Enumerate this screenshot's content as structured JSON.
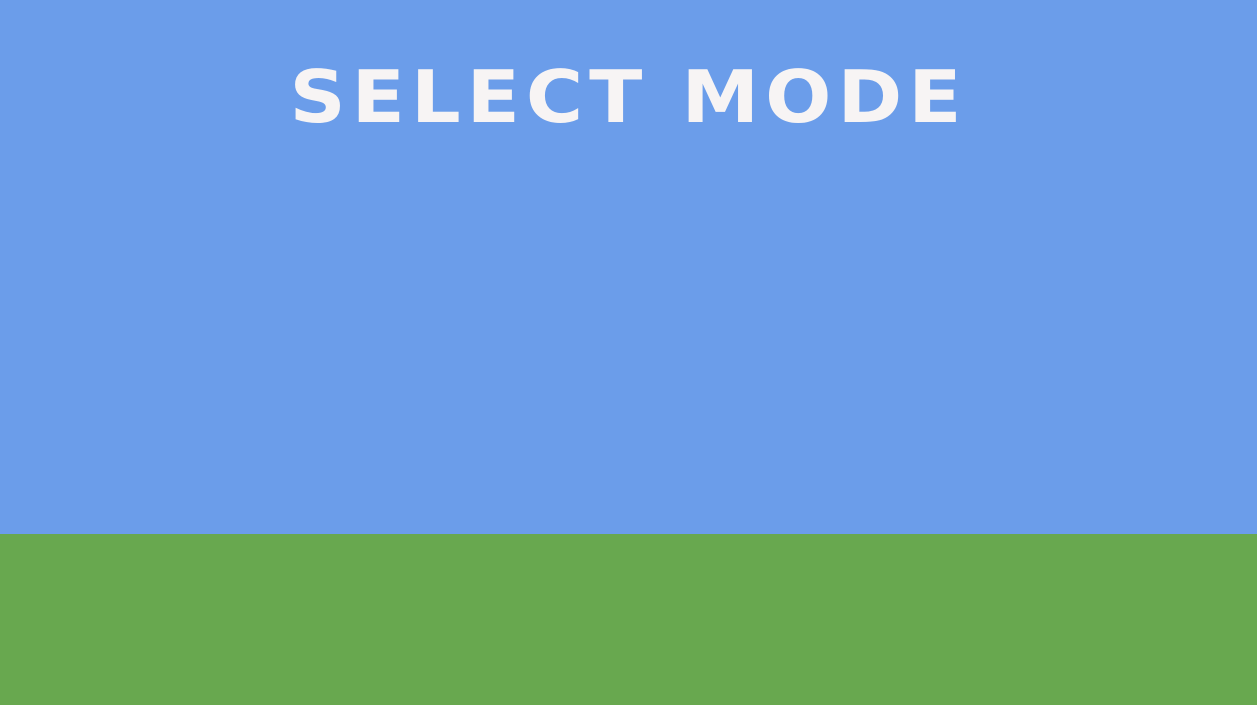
{
  "title": "SELECT MODE",
  "colors": {
    "sky": "#6B9DEA",
    "ground": "#68A84F",
    "title": "#F7F4F4"
  }
}
